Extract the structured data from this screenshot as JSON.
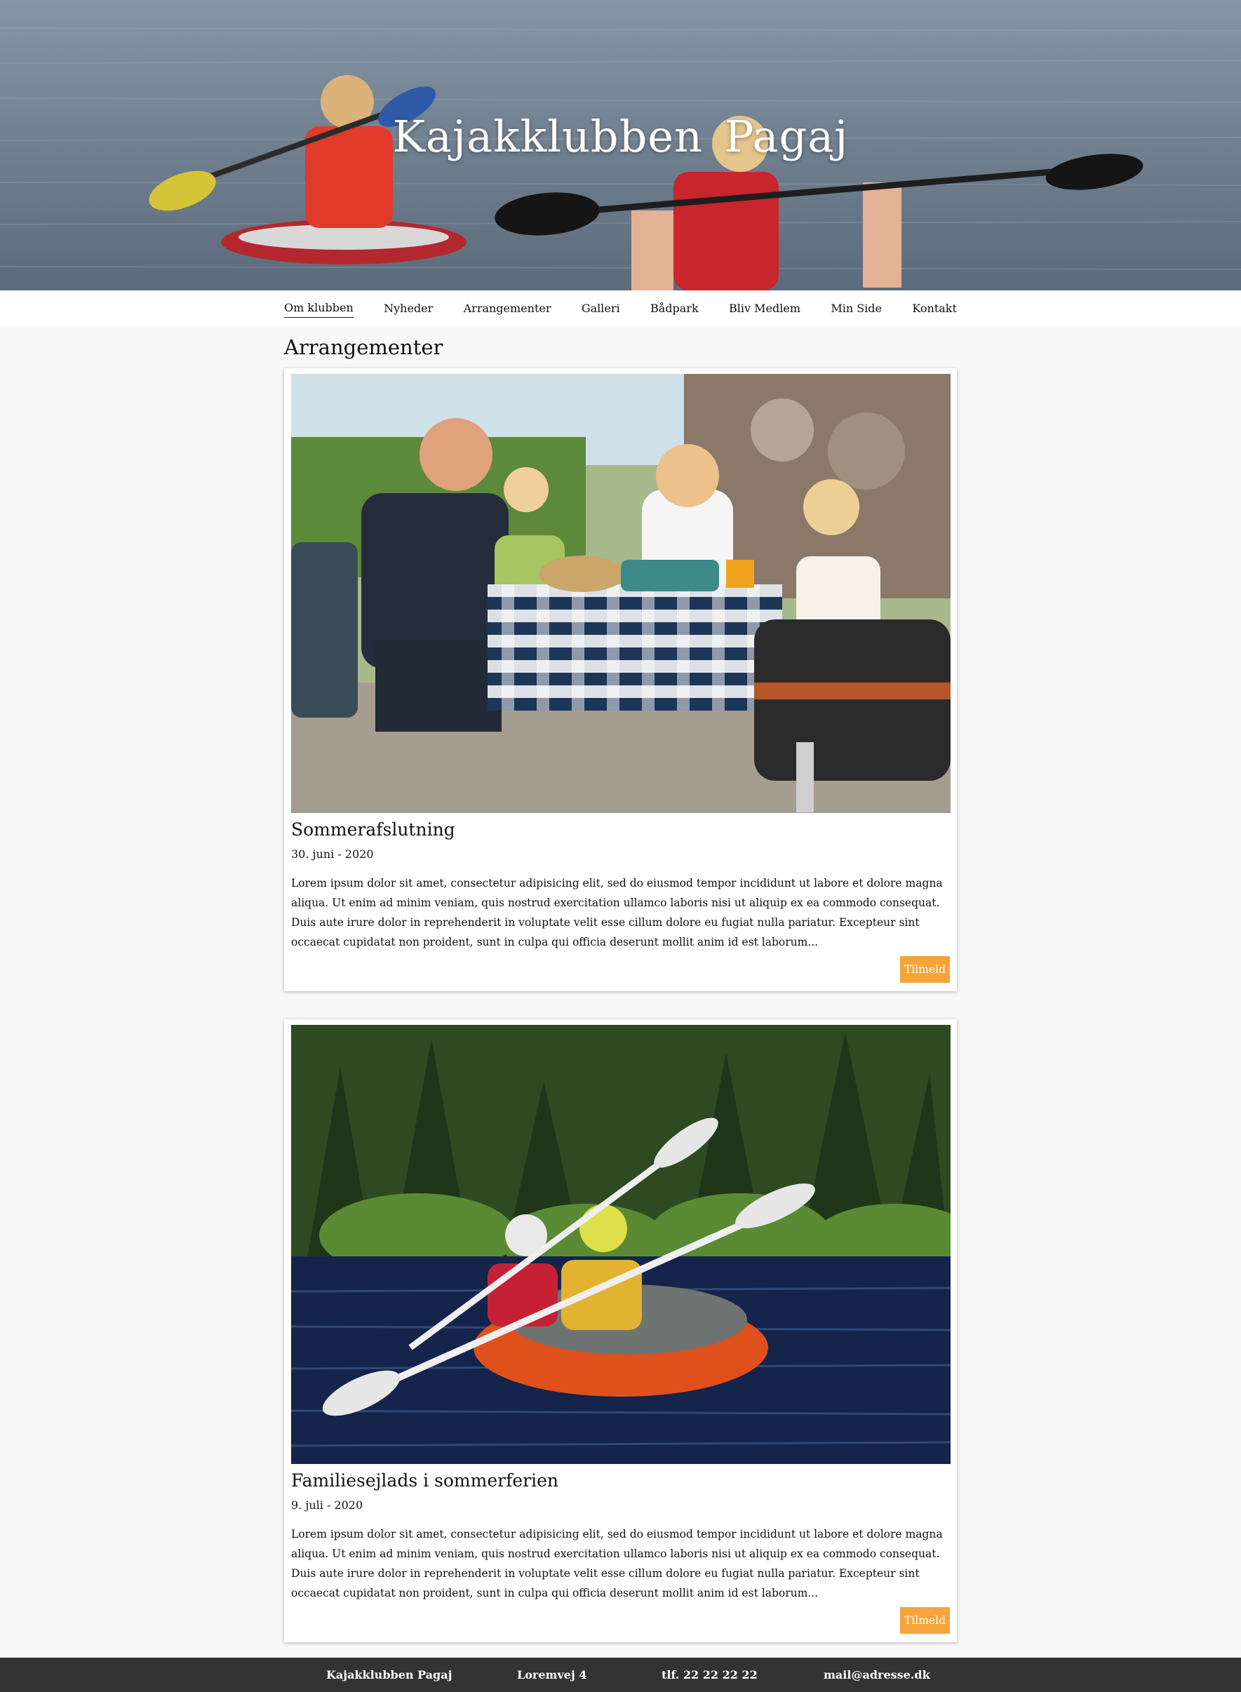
{
  "site": {
    "title": "Kajakklubben  Pagaj"
  },
  "nav": {
    "items": [
      {
        "label": "Om klubben",
        "active": true
      },
      {
        "label": "Nyheder",
        "active": false
      },
      {
        "label": "Arrangementer",
        "active": false
      },
      {
        "label": "Galleri",
        "active": false
      },
      {
        "label": "Bådpark",
        "active": false
      },
      {
        "label": "Bliv Medlem",
        "active": false
      },
      {
        "label": "Min Side",
        "active": false
      },
      {
        "label": "Kontakt",
        "active": false
      }
    ]
  },
  "page": {
    "title": "Arrangementer"
  },
  "events": [
    {
      "title": "Sommerafslutning",
      "date": "30. juni - 2020",
      "text": "Lorem ipsum dolor sit amet, consectetur adipisicing elit, sed do eiusmod tempor incididunt ut labore et dolore magna aliqua. Ut enim ad minim veniam, quis nostrud exercitation ullamco laboris nisi ut aliquip ex ea commodo consequat. Duis aute irure dolor in reprehenderit in voluptate velit esse cillum dolore eu fugiat nulla pariatur. Excepteur sint occaecat cupidatat non proident, sunt in culpa qui officia deserunt mollit anim id est laborum...",
      "button": "Tilmeld"
    },
    {
      "title": "Familiesejlads i sommerferien",
      "date": "9. juli - 2020",
      "text": "Lorem ipsum dolor sit amet, consectetur adipisicing elit, sed do eiusmod tempor incididunt ut labore et dolore magna aliqua. Ut enim ad minim veniam, quis nostrud exercitation ullamco laboris nisi ut aliquip ex ea commodo consequat. Duis aute irure dolor in reprehenderit in voluptate velit esse cillum dolore eu fugiat nulla pariatur. Excepteur sint occaecat cupidatat non proident, sunt in culpa qui officia deserunt mollit anim id est laborum...",
      "button": "Tilmeld"
    }
  ],
  "footer": {
    "name": "Kajakklubben Pagaj",
    "address": "Loremvej 4",
    "phone": "tlf. 22 22 22 22",
    "email": "mail@adresse.dk"
  },
  "colors": {
    "accent": "#f6a33a",
    "footer_bg": "#333333",
    "page_bg": "#f8f8f8"
  }
}
